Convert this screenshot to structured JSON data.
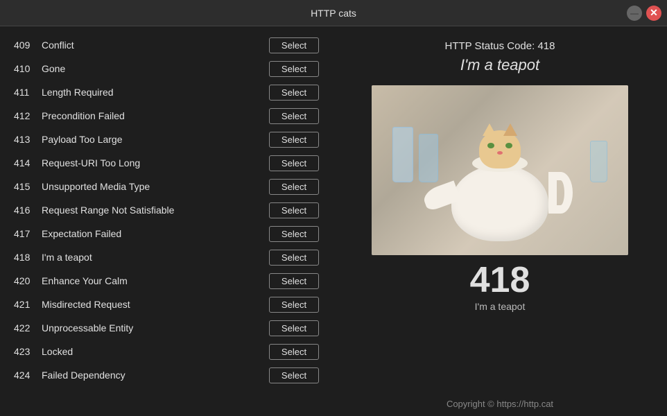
{
  "titleBar": {
    "title": "HTTP cats",
    "minimizeLabel": "—",
    "closeLabel": "✕"
  },
  "leftPanel": {
    "selectLabel": "Select",
    "items": [
      {
        "code": "409",
        "name": "Conflict"
      },
      {
        "code": "410",
        "name": "Gone"
      },
      {
        "code": "411",
        "name": "Length Required"
      },
      {
        "code": "412",
        "name": "Precondition Failed"
      },
      {
        "code": "413",
        "name": "Payload Too Large"
      },
      {
        "code": "414",
        "name": "Request-URI Too Long"
      },
      {
        "code": "415",
        "name": "Unsupported Media Type"
      },
      {
        "code": "416",
        "name": "Request Range Not Satisfiable"
      },
      {
        "code": "417",
        "name": "Expectation Failed"
      },
      {
        "code": "418",
        "name": "I'm a teapot"
      },
      {
        "code": "420",
        "name": "Enhance Your Calm"
      },
      {
        "code": "421",
        "name": "Misdirected Request"
      },
      {
        "code": "422",
        "name": "Unprocessable Entity"
      },
      {
        "code": "423",
        "name": "Locked"
      },
      {
        "code": "424",
        "name": "Failed Dependency"
      }
    ]
  },
  "rightPanel": {
    "statusHeader": "HTTP Status Code: 418",
    "statusTagline": "I'm a teapot",
    "statusNumber": "418",
    "statusNameDisplay": "I'm a teapot",
    "copyright": "Copyright © https://http.cat"
  }
}
